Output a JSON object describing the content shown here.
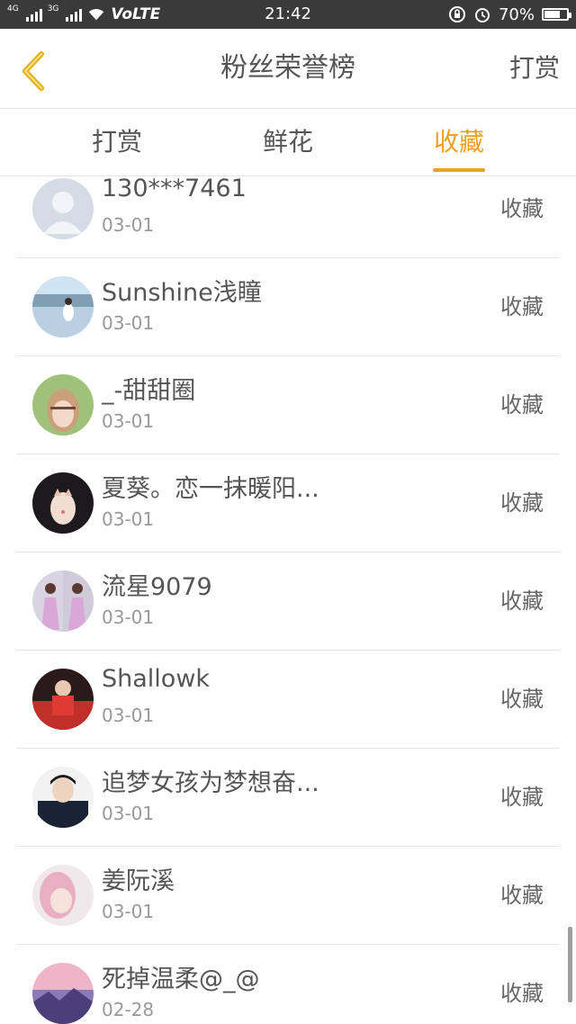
{
  "status_bar": {
    "net1": "4G",
    "net2": "3G",
    "volte": "VoLTE",
    "time": "21:42",
    "battery_text": "70%",
    "battery_level": 0.7
  },
  "header": {
    "title": "粉丝荣誉榜",
    "right_action": "打赏"
  },
  "tabs": [
    {
      "label": "打赏",
      "active": false
    },
    {
      "label": "鲜花",
      "active": false
    },
    {
      "label": "收藏",
      "active": true
    }
  ],
  "list": [
    {
      "name": "130***7461",
      "date": "03-01",
      "action": "收藏",
      "avatar": "default-avatar"
    },
    {
      "name": "Sunshine浅瞳",
      "date": "03-01",
      "action": "收藏",
      "avatar": "seaside-photo"
    },
    {
      "name": "_-甜甜圈",
      "date": "03-01",
      "action": "收藏",
      "avatar": "girl-portrait"
    },
    {
      "name": "夏葵。恋一抹暖阳...",
      "date": "03-01",
      "action": "收藏",
      "avatar": "girl-cat-filter"
    },
    {
      "name": "流星9079",
      "date": "03-01",
      "action": "收藏",
      "avatar": "two-girls-dresses"
    },
    {
      "name": "Shallowk",
      "date": "03-01",
      "action": "收藏",
      "avatar": "red-motorbike"
    },
    {
      "name": "追梦女孩为梦想奋...",
      "date": "03-01",
      "action": "收藏",
      "avatar": "boy-navy-sweater"
    },
    {
      "name": "姜阮溪",
      "date": "03-01",
      "action": "收藏",
      "avatar": "pink-hair-girl"
    },
    {
      "name": "死掉温柔@_@",
      "date": "02-28",
      "action": "收藏",
      "avatar": "sunset-mountains"
    }
  ],
  "colors": {
    "accent": "#f0a020",
    "back_arrow": "#e0b020",
    "status_bar_bg": "#3a3a3a"
  }
}
